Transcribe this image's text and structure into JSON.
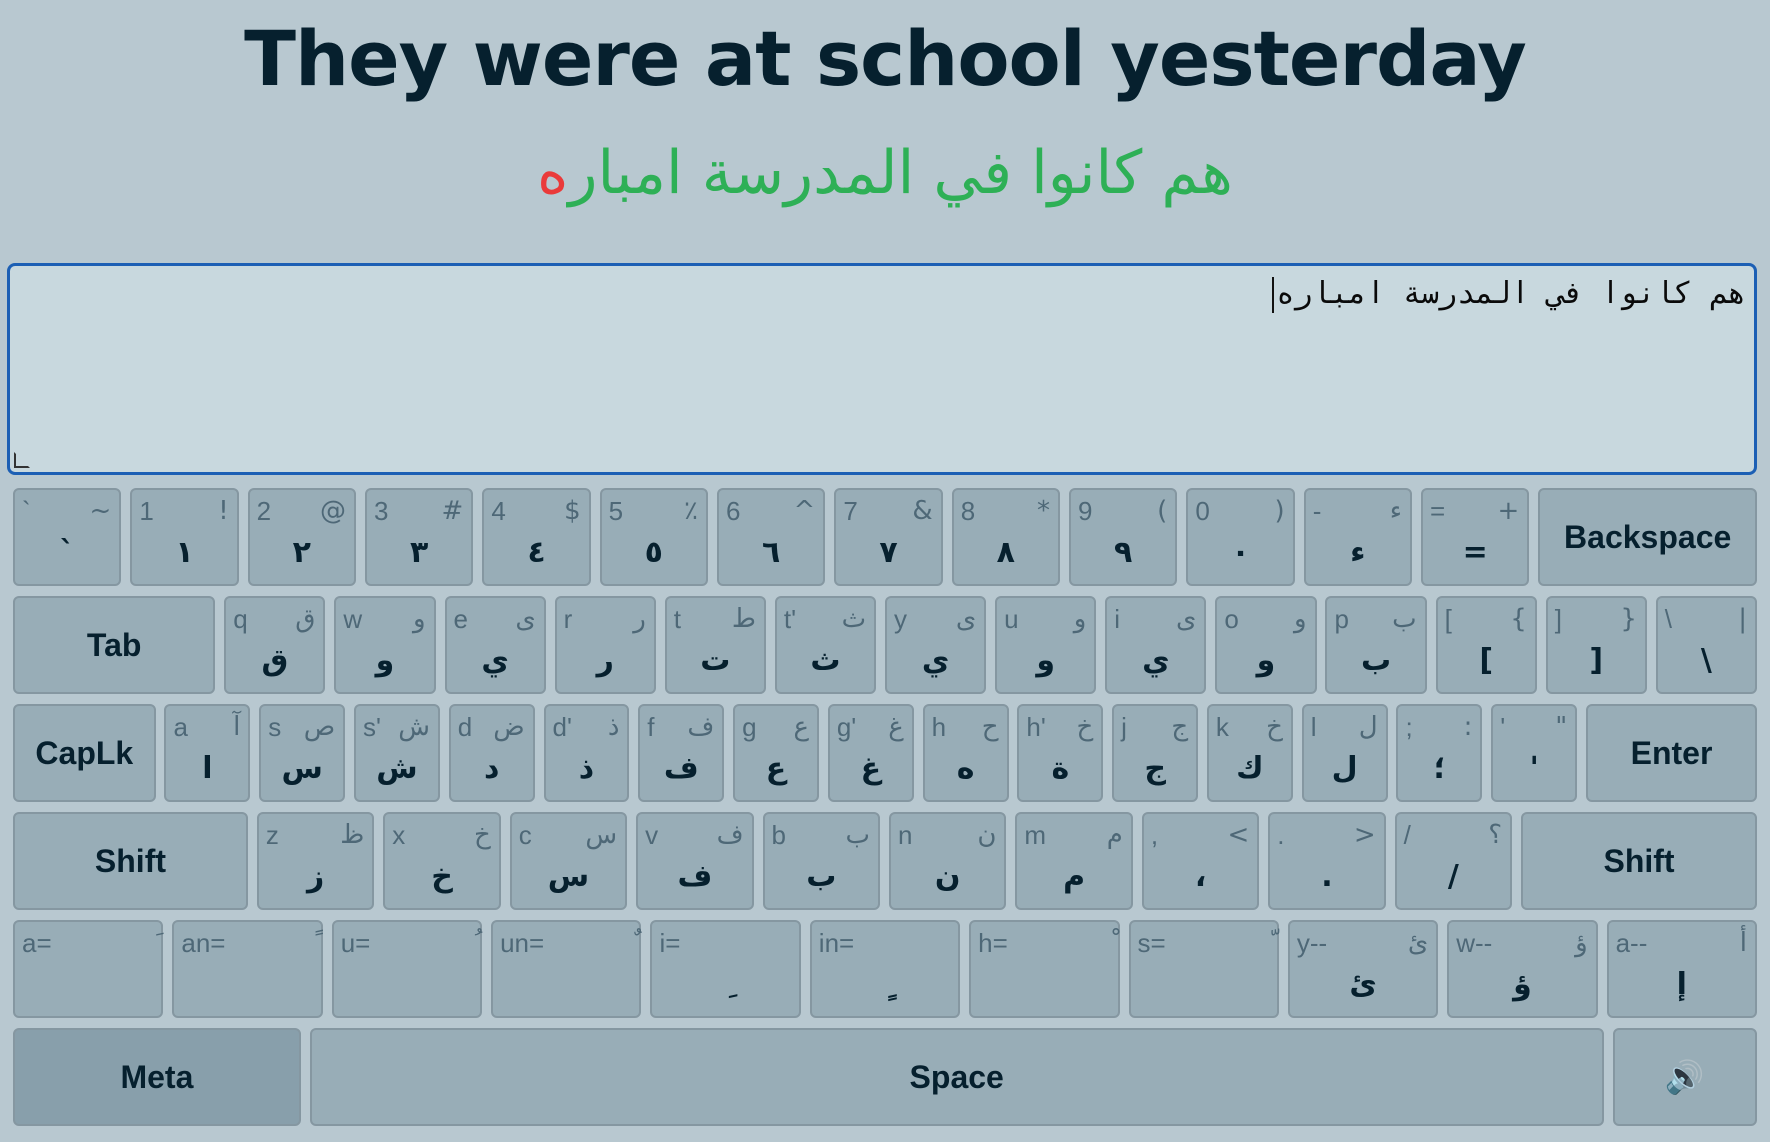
{
  "prompt": {
    "english": "They were at school yesterday",
    "arabic_correct": "هم كانوا في المدرسة امبار",
    "arabic_error": "ه"
  },
  "input": {
    "value": "هم كانوا في المدرسة امباره"
  },
  "rows": [
    [
      {
        "id": "backtick",
        "lt": "`",
        "rt": "~",
        "main": "`"
      },
      {
        "id": "1",
        "lt": "1",
        "rt": "!",
        "main": "١"
      },
      {
        "id": "2",
        "lt": "2",
        "rt": "@",
        "main": "٢"
      },
      {
        "id": "3",
        "lt": "3",
        "rt": "#",
        "main": "٣"
      },
      {
        "id": "4",
        "lt": "4",
        "rt": "$",
        "main": "٤"
      },
      {
        "id": "5",
        "lt": "5",
        "rt": "٪",
        "main": "٥"
      },
      {
        "id": "6",
        "lt": "6",
        "rt": "^",
        "main": "٦"
      },
      {
        "id": "7",
        "lt": "7",
        "rt": "&",
        "main": "٧"
      },
      {
        "id": "8",
        "lt": "8",
        "rt": "*",
        "main": "٨"
      },
      {
        "id": "9",
        "lt": "9",
        "rt": "(",
        "main": "٩"
      },
      {
        "id": "0",
        "lt": "0",
        "rt": ")",
        "main": "٠"
      },
      {
        "id": "minus",
        "lt": "-",
        "rt": "ء",
        "main": "ء"
      },
      {
        "id": "equals",
        "lt": "=",
        "rt": "+",
        "main": "="
      },
      {
        "id": "backspace",
        "label": "Backspace"
      }
    ],
    [
      {
        "id": "tab",
        "label": "Tab"
      },
      {
        "id": "q",
        "lt": "q",
        "rt": "ق",
        "main": "ق"
      },
      {
        "id": "w",
        "lt": "w",
        "rt": "و",
        "main": "و"
      },
      {
        "id": "e",
        "lt": "e",
        "rt": "ى",
        "main": "ي"
      },
      {
        "id": "r",
        "lt": "r",
        "rt": "ر",
        "main": "ر"
      },
      {
        "id": "t",
        "lt": "t",
        "rt": "ط",
        "main": "ت"
      },
      {
        "id": "t2",
        "lt": "t'",
        "rt": "ث",
        "main": "ث"
      },
      {
        "id": "y",
        "lt": "y",
        "rt": "ى",
        "main": "ي"
      },
      {
        "id": "u",
        "lt": "u",
        "rt": "و",
        "main": "و"
      },
      {
        "id": "i",
        "lt": "i",
        "rt": "ى",
        "main": "ي"
      },
      {
        "id": "o",
        "lt": "o",
        "rt": "و",
        "main": "و"
      },
      {
        "id": "p",
        "lt": "p",
        "rt": "ب",
        "main": "ب"
      },
      {
        "id": "lbracket",
        "lt": "[",
        "rt": "{",
        "main": "["
      },
      {
        "id": "rbracket",
        "lt": "]",
        "rt": "}",
        "main": "]"
      },
      {
        "id": "backslash",
        "lt": "\\",
        "rt": "|",
        "main": "\\"
      }
    ],
    [
      {
        "id": "caplk",
        "label": "CapLk"
      },
      {
        "id": "a",
        "lt": "a",
        "rt": "آ",
        "main": "ا"
      },
      {
        "id": "s",
        "lt": "s",
        "rt": "ص",
        "main": "س"
      },
      {
        "id": "s2",
        "lt": "s'",
        "rt": "ش",
        "main": "ش"
      },
      {
        "id": "d",
        "lt": "d",
        "rt": "ض",
        "main": "د"
      },
      {
        "id": "d2",
        "lt": "d'",
        "rt": "ذ",
        "main": "ذ"
      },
      {
        "id": "f",
        "lt": "f",
        "rt": "ف",
        "main": "ف"
      },
      {
        "id": "g",
        "lt": "g",
        "rt": "ع",
        "main": "ع"
      },
      {
        "id": "g2",
        "lt": "g'",
        "rt": "غ",
        "main": "غ"
      },
      {
        "id": "h",
        "lt": "h",
        "rt": "ح",
        "main": "ه"
      },
      {
        "id": "h2",
        "lt": "h'",
        "rt": "خ",
        "main": "ة"
      },
      {
        "id": "j",
        "lt": "j",
        "rt": "ج",
        "main": "ج"
      },
      {
        "id": "k",
        "lt": "k",
        "rt": "خ",
        "main": "ك"
      },
      {
        "id": "l",
        "lt": "l",
        "rt": "ل",
        "main": "ل"
      },
      {
        "id": "semicolon",
        "lt": ";",
        "rt": ":",
        "main": "؛"
      },
      {
        "id": "quote",
        "lt": "'",
        "rt": "\"",
        "main": "'"
      },
      {
        "id": "enter",
        "label": "Enter"
      }
    ],
    [
      {
        "id": "shift-left",
        "label": "Shift"
      },
      {
        "id": "z",
        "lt": "z",
        "rt": "ظ",
        "main": "ز"
      },
      {
        "id": "x",
        "lt": "x",
        "rt": "خ",
        "main": "خ"
      },
      {
        "id": "c",
        "lt": "c",
        "rt": "س",
        "main": "س"
      },
      {
        "id": "v",
        "lt": "v",
        "rt": "ف",
        "main": "ف"
      },
      {
        "id": "b",
        "lt": "b",
        "rt": "ب",
        "main": "ب"
      },
      {
        "id": "n",
        "lt": "n",
        "rt": "ن",
        "main": "ن"
      },
      {
        "id": "m",
        "lt": "m",
        "rt": "م",
        "main": "م"
      },
      {
        "id": "comma",
        "lt": ",",
        "rt": "<",
        "main": "،"
      },
      {
        "id": "period",
        "lt": ".",
        "rt": ">",
        "main": "."
      },
      {
        "id": "slash",
        "lt": "/",
        "rt": "؟",
        "main": "/"
      },
      {
        "id": "shift-right",
        "label": "Shift"
      }
    ],
    [
      {
        "id": "fatha",
        "lt": "a=",
        "rt": "َ",
        "main": ""
      },
      {
        "id": "fathatan",
        "lt": "an=",
        "rt": "ً",
        "main": ""
      },
      {
        "id": "damma",
        "lt": "u=",
        "rt": "ُ",
        "main": ""
      },
      {
        "id": "dammatan",
        "lt": "un=",
        "rt": "ٌ",
        "main": ""
      },
      {
        "id": "kasra",
        "lt": "i=",
        "rt": "",
        "main": "ِ"
      },
      {
        "id": "kasratan",
        "lt": "in=",
        "rt": "",
        "main": "ٍ"
      },
      {
        "id": "sukun",
        "lt": "h=",
        "rt": "ْ",
        "main": ""
      },
      {
        "id": "shadda",
        "lt": "s=",
        "rt": "ّ",
        "main": ""
      },
      {
        "id": "yaa-hamza",
        "lt": "y--",
        "rt": "ئ",
        "main": "ئ"
      },
      {
        "id": "waw-hamza",
        "lt": "w--",
        "rt": "ؤ",
        "main": "ؤ"
      },
      {
        "id": "alif-hamza",
        "lt": "a--",
        "rt": "أ",
        "main": "إ"
      }
    ],
    [
      {
        "id": "meta",
        "label": "Meta"
      },
      {
        "id": "space",
        "label": "Space"
      },
      {
        "id": "sound",
        "label": "🔊"
      }
    ]
  ]
}
